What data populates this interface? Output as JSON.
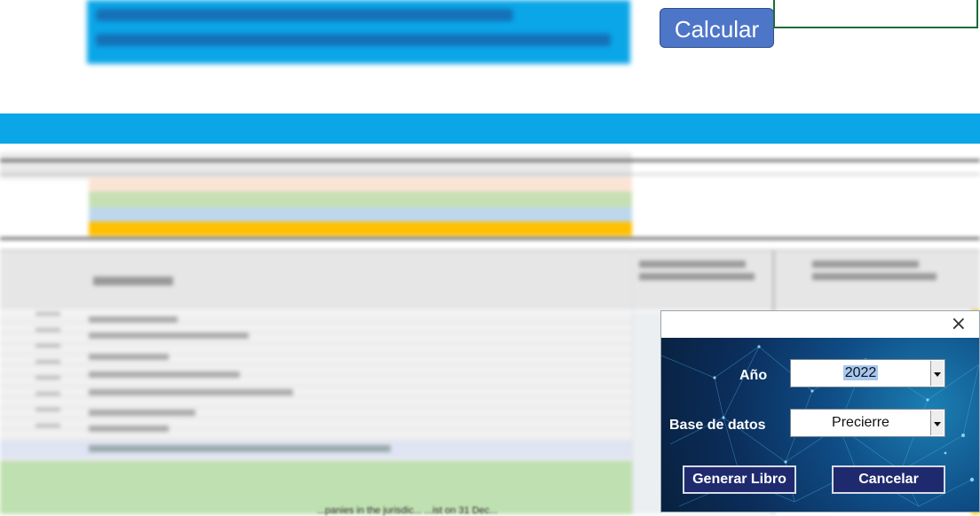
{
  "toolbar": {
    "calculate_label": "Calcular"
  },
  "dialog": {
    "close_glyph": "×",
    "year_label": "Año",
    "year_value": "2022",
    "database_label": "Base de datos",
    "database_value": "Precierre",
    "generate_button": "Generar Libro",
    "cancel_button": "Cancelar"
  },
  "sheet": {
    "footer_fragment": "...panies in the jurisdic... ...ist on 31 Dec..."
  },
  "colors": {
    "banner_blue": "#0aa6e8",
    "button_blue": "#4d76c8",
    "dialog_button": "#1f2a6e",
    "row_peach": "#fbe4d5",
    "row_green": "#c6e0b4",
    "row_lightblue": "#bdd7ee",
    "row_gold": "#ffc000"
  }
}
